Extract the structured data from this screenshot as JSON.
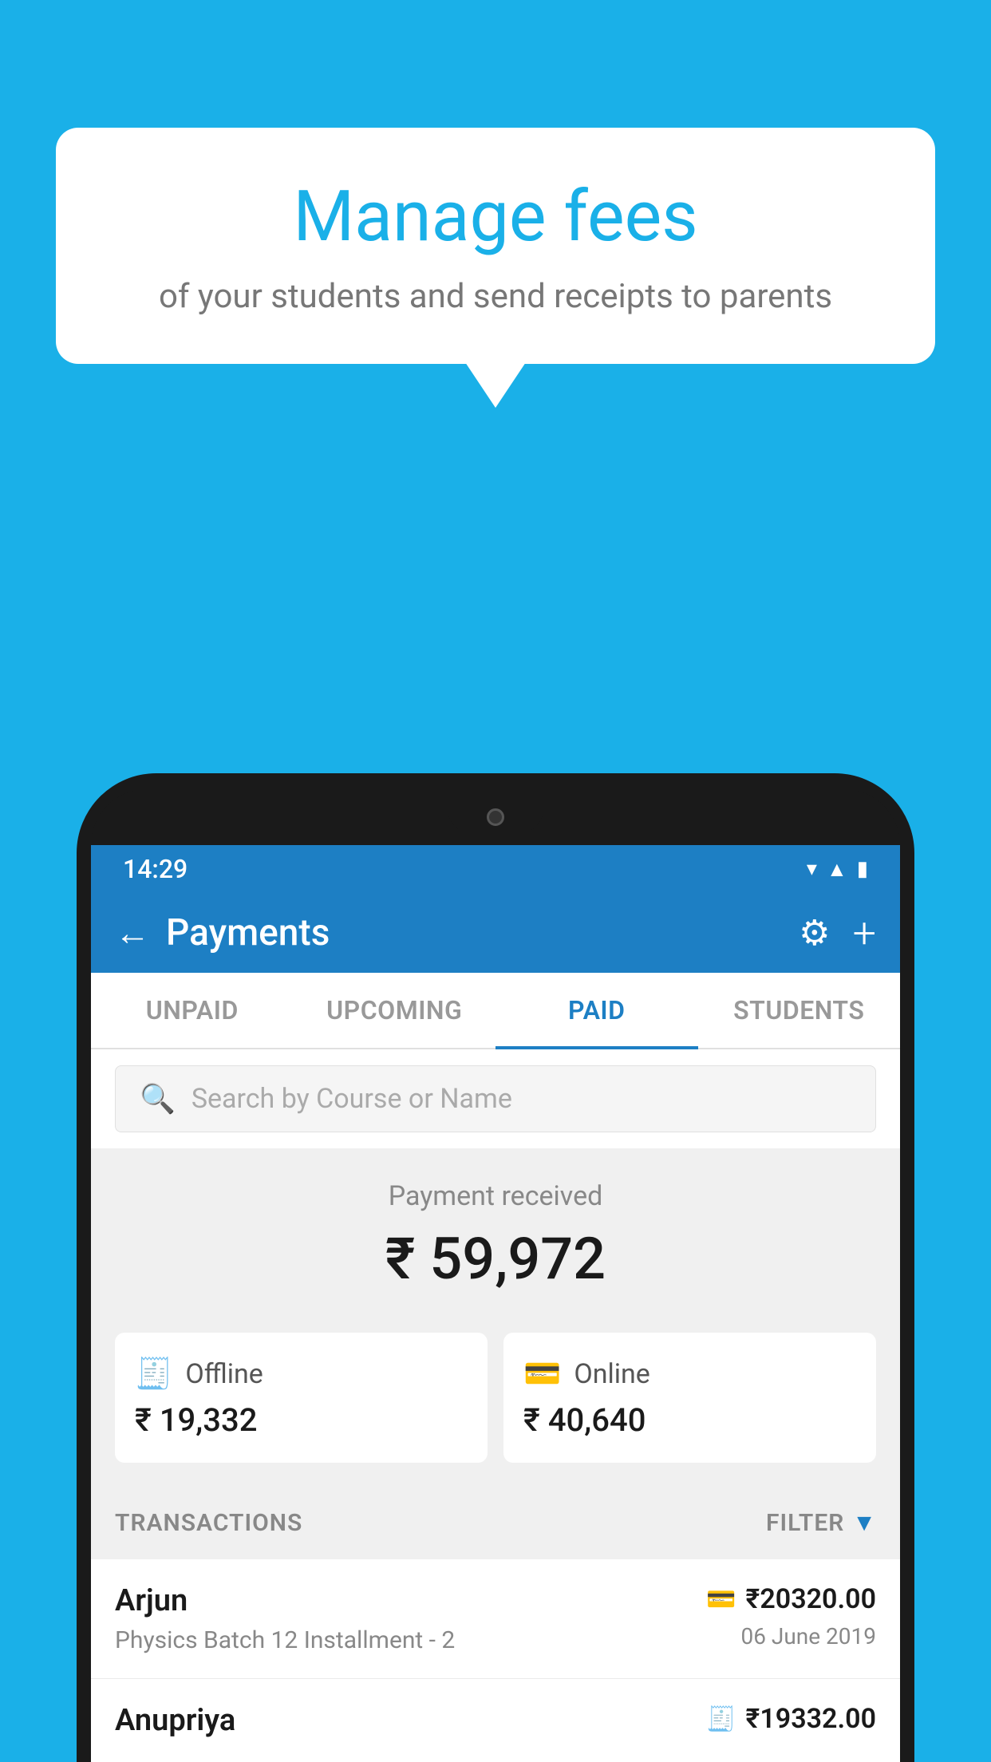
{
  "background": {
    "color": "#1ab0e8"
  },
  "bubble": {
    "title": "Manage fees",
    "subtitle": "of your students and send receipts to parents"
  },
  "statusBar": {
    "time": "14:29",
    "icons": [
      "▼",
      "◂",
      "▮"
    ]
  },
  "appBar": {
    "title": "Payments",
    "backLabel": "←",
    "settingsIcon": "⚙",
    "addIcon": "+"
  },
  "tabs": [
    {
      "id": "unpaid",
      "label": "UNPAID",
      "active": false
    },
    {
      "id": "upcoming",
      "label": "UPCOMING",
      "active": false
    },
    {
      "id": "paid",
      "label": "PAID",
      "active": true
    },
    {
      "id": "students",
      "label": "STUDENTS",
      "active": false
    }
  ],
  "search": {
    "placeholder": "Search by Course or Name"
  },
  "paymentSummary": {
    "label": "Payment received",
    "amount": "₹ 59,972"
  },
  "paymentCards": [
    {
      "id": "offline",
      "label": "Offline",
      "amount": "₹ 19,332",
      "icon": "💳"
    },
    {
      "id": "online",
      "label": "Online",
      "amount": "₹ 40,640",
      "icon": "💳"
    }
  ],
  "transactions": {
    "sectionLabel": "TRANSACTIONS",
    "filterLabel": "FILTER",
    "items": [
      {
        "name": "Arjun",
        "detail": "Physics Batch 12 Installment - 2",
        "amount": "₹20320.00",
        "date": "06 June 2019",
        "paymentType": "online"
      },
      {
        "name": "Anupriya",
        "detail": "",
        "amount": "₹19332.00",
        "date": "",
        "paymentType": "offline"
      }
    ]
  }
}
